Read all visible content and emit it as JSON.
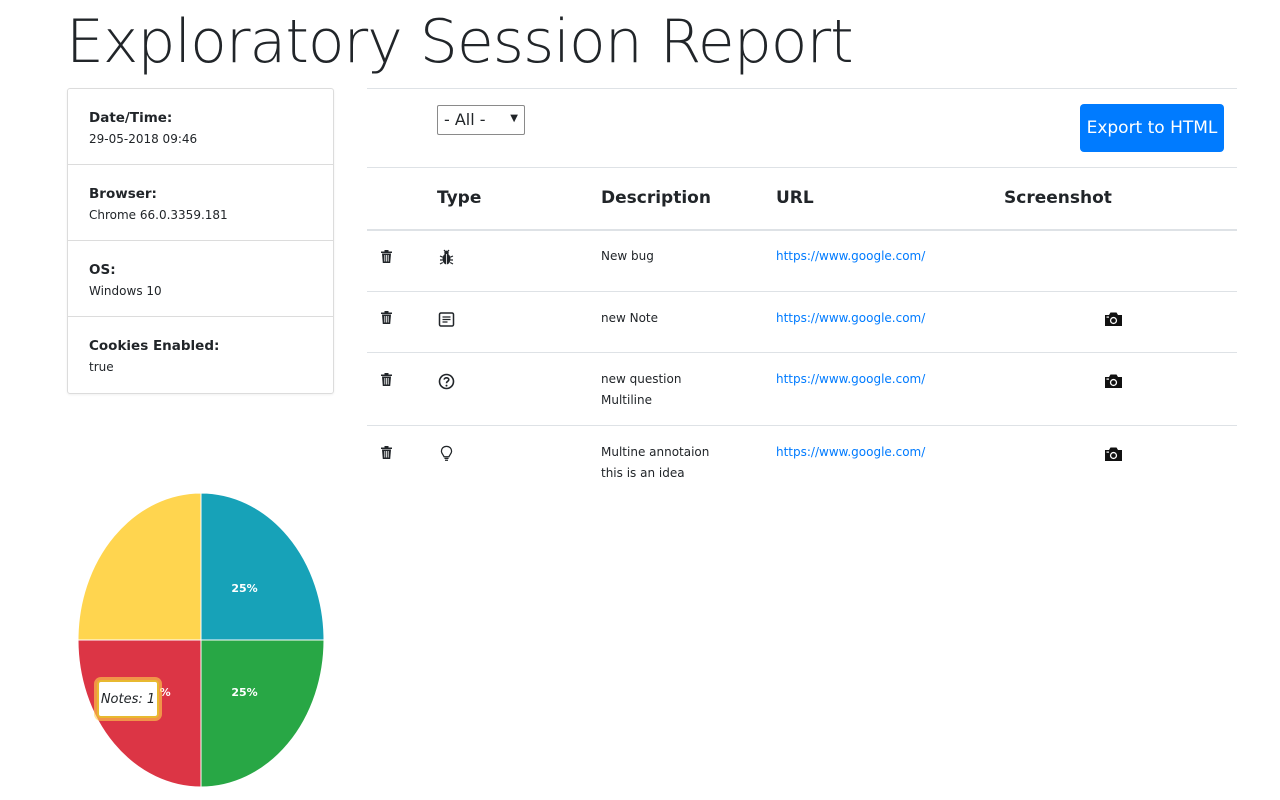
{
  "page_title": "Exploratory Session Report",
  "info": [
    {
      "label": "Date/Time:",
      "value": "29-05-2018 09:46"
    },
    {
      "label": "Browser:",
      "value": "Chrome 66.0.3359.181"
    },
    {
      "label": "OS:",
      "value": "Windows 10"
    },
    {
      "label": "Cookies Enabled:",
      "value": "true"
    }
  ],
  "filter": {
    "selected": "- All -"
  },
  "export_button": "Export to HTML",
  "table": {
    "headers": {
      "type": "Type",
      "description": "Description",
      "url": "URL",
      "screenshot": "Screenshot"
    },
    "rows": [
      {
        "type_icon": "bug-icon",
        "description": [
          "New bug"
        ],
        "url": "https://www.google.com/",
        "screenshot": false
      },
      {
        "type_icon": "note-icon",
        "description": [
          "new Note"
        ],
        "url": "https://www.google.com/",
        "screenshot": true
      },
      {
        "type_icon": "question-icon",
        "description": [
          "new question",
          "Multiline"
        ],
        "url": "https://www.google.com/",
        "screenshot": true
      },
      {
        "type_icon": "idea-icon",
        "description": [
          "Multine annotaion",
          "this is an idea"
        ],
        "url": "https://www.google.com/",
        "screenshot": true
      }
    ]
  },
  "chart_data": {
    "type": "pie",
    "slices": [
      {
        "label": "25%",
        "value": 25,
        "color": "#17a2b8"
      },
      {
        "label": "25%",
        "value": 25,
        "color": "#28a745"
      },
      {
        "label": "25%",
        "value": 25,
        "color": "#dc3545"
      },
      {
        "label": "",
        "value": 25,
        "color": "#ffd54f"
      }
    ],
    "tooltip": "Notes: 1"
  }
}
